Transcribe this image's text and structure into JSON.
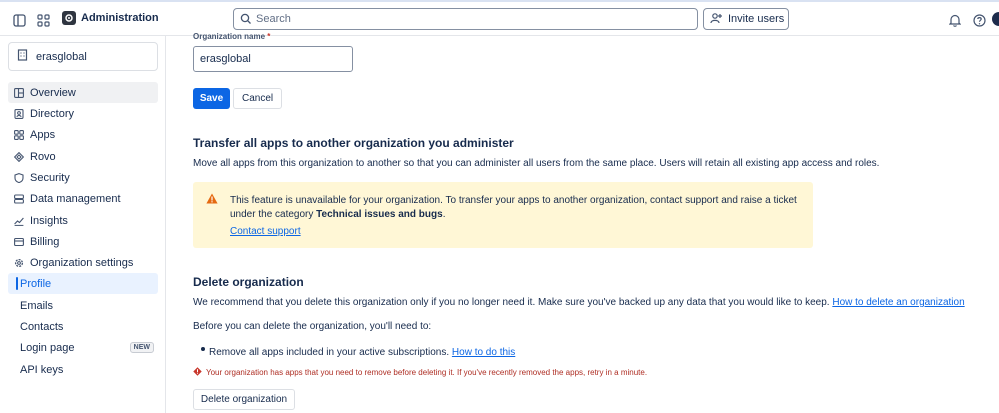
{
  "app": {
    "title": "Administration"
  },
  "search": {
    "placeholder": "Search"
  },
  "header": {
    "invite_label": "Invite users"
  },
  "sidebar": {
    "org_name": "erasglobal",
    "items": [
      {
        "label": "Overview",
        "icon": "overview-icon"
      },
      {
        "label": "Directory",
        "icon": "directory-icon"
      },
      {
        "label": "Apps",
        "icon": "apps-icon"
      },
      {
        "label": "Rovo",
        "icon": "rovo-icon"
      },
      {
        "label": "Security",
        "icon": "shield-icon"
      },
      {
        "label": "Data management",
        "icon": "database-icon"
      },
      {
        "label": "Insights",
        "icon": "chart-icon"
      },
      {
        "label": "Billing",
        "icon": "card-icon"
      },
      {
        "label": "Organization settings",
        "icon": "gear-icon"
      }
    ],
    "sub_items": [
      {
        "label": "Profile",
        "selected": true
      },
      {
        "label": "Emails"
      },
      {
        "label": "Contacts"
      },
      {
        "label": "Login page",
        "badge": "NEW"
      },
      {
        "label": "API keys"
      }
    ]
  },
  "form": {
    "label": "Organization name",
    "required_mark": "*",
    "value": "erasglobal",
    "save_label": "Save",
    "cancel_label": "Cancel"
  },
  "transfer": {
    "title": "Transfer all apps to another organization you administer",
    "description": "Move all apps from this organization to another so that you can administer all users from the same place. Users will retain all existing app access and roles.",
    "warning_text": "This feature is unavailable for your organization. To transfer your apps to another organization, contact support and raise a ticket under the category ",
    "warning_bold": "Technical issues and bugs",
    "warning_end": ".",
    "warning_link": "Contact support"
  },
  "delete": {
    "title": "Delete organization",
    "description": "We recommend that you delete this organization only if you no longer need it. Make sure you've backed up any data that you would like to keep.",
    "description_link": "How to delete an organization",
    "prereq": "Before you can delete the organization, you'll need to:",
    "bullet_text": "Remove all apps included in your active subscriptions.",
    "bullet_link": "How to do this",
    "error": "Your organization has apps that you need to remove before deleting it. If you've recently removed the apps, retry in a minute.",
    "button_label": "Delete organization"
  },
  "colors": {
    "primary": "#0c66e4",
    "warning_bg": "#fff7d6",
    "error": "#ae2e24"
  }
}
